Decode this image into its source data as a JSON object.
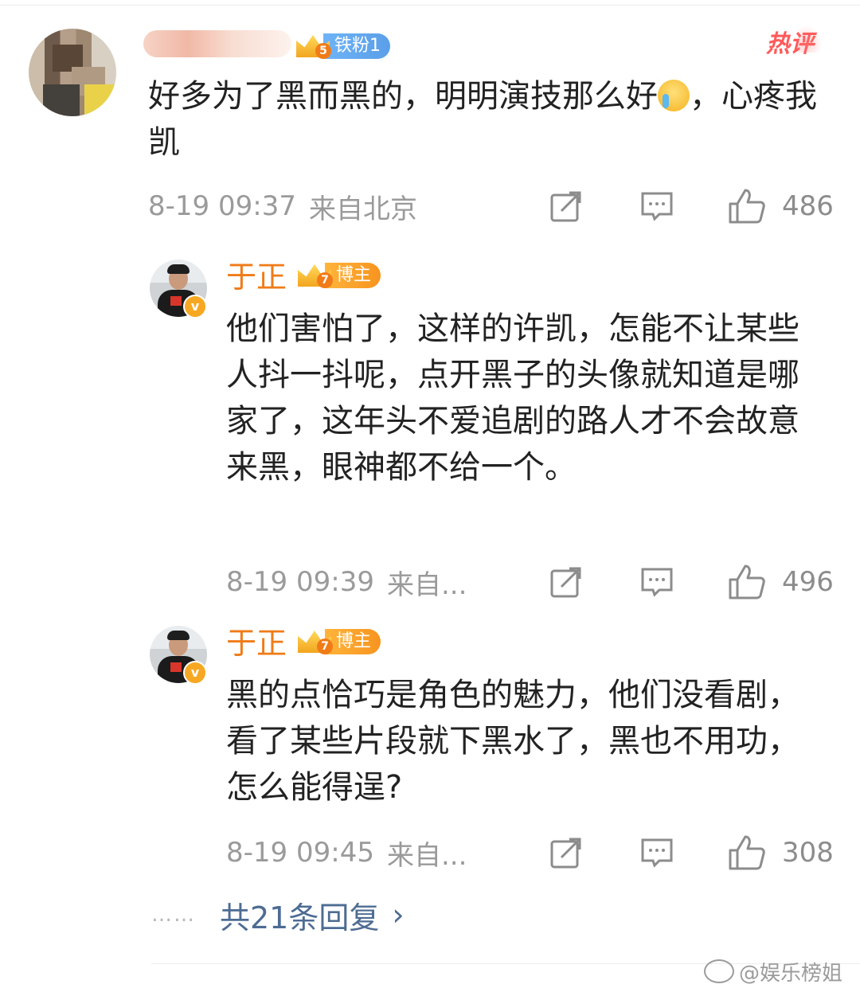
{
  "comment": {
    "badge_label": "铁粉1",
    "badge_level": "5",
    "hot_label": "热评",
    "text": "好多为了黑而黑的，明明演技那么好",
    "text_after_emoji": "，心疼我凯",
    "time": "8-19 09:37",
    "location": "来自北京",
    "likes": "486"
  },
  "replies": [
    {
      "author": "于正",
      "badge_label": "博主",
      "badge_level": "7",
      "verified_mark": "v",
      "text": "他们害怕了，这样的许凯，怎能不让某些人抖一抖呢，点开黑子的头像就知道是哪家了，这年头不爱追剧的路人才不会故意来黑，眼神都不给一个。",
      "time": "8-19 09:39",
      "location": "来自...",
      "likes": "496"
    },
    {
      "author": "于正",
      "badge_label": "博主",
      "badge_level": "7",
      "verified_mark": "v",
      "text": "黑的点恰巧是角色的魅力，他们没看剧，看了某些片段就下黑水了，黑也不用功，怎么能得逞?",
      "time": "8-19 09:45",
      "location": "来自...",
      "likes": "308"
    }
  ],
  "more": {
    "dots": "……",
    "label": "共21条回复",
    "chevron": "›"
  },
  "watermark": "@娱乐榜姐",
  "icons": {
    "share": "share-icon",
    "comment": "comment-icon",
    "like": "thumbs-up-icon"
  }
}
